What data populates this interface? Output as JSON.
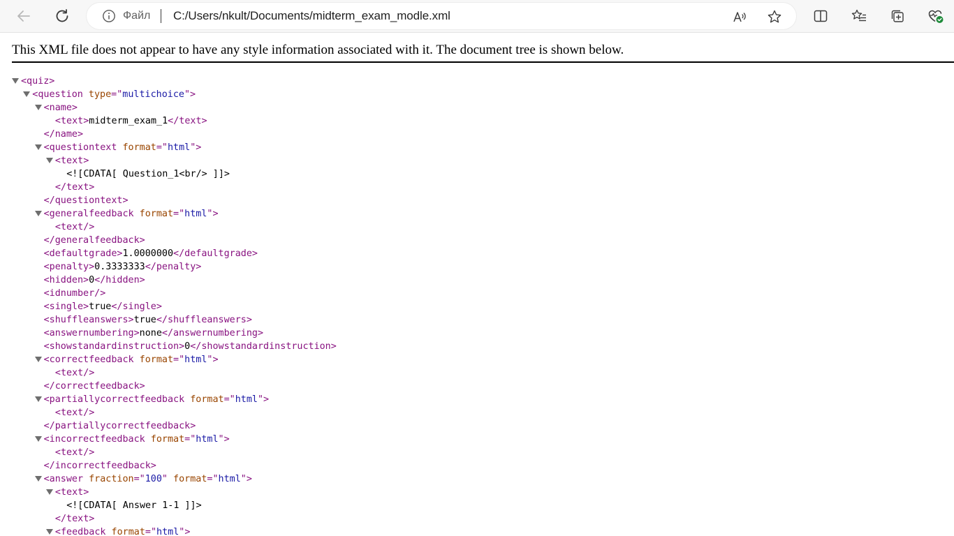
{
  "browser": {
    "site_label": "Файл",
    "url": "C:/Users/nkult/Documents/midterm_exam_modle.xml",
    "icons": {
      "back": "arrow-left-icon",
      "reload": "reload-icon",
      "info": "info-circle-icon",
      "read_aloud": "read-aloud-icon",
      "favorite": "star-icon",
      "split_screen": "split-screen-icon",
      "favorites": "favorites-list-icon",
      "collections": "collections-icon",
      "profile": "heart-pulse-icon"
    }
  },
  "xml_info": "This XML file does not appear to have any style information associated with it. The document tree is shown below.",
  "tree_lines": [
    {
      "indent": 0,
      "tog": true,
      "parts": [
        [
          "tag",
          "<quiz>"
        ]
      ]
    },
    {
      "indent": 1,
      "tog": true,
      "parts": [
        [
          "tag",
          "<question"
        ],
        [
          "txt",
          " "
        ],
        [
          "attr",
          "type"
        ],
        [
          "tag",
          "=\""
        ],
        [
          "val",
          "multichoice"
        ],
        [
          "tag",
          "\">"
        ]
      ]
    },
    {
      "indent": 2,
      "tog": true,
      "parts": [
        [
          "tag",
          "<name>"
        ]
      ]
    },
    {
      "indent": 3,
      "tog": false,
      "parts": [
        [
          "tag",
          "<text>"
        ],
        [
          "txt",
          "midterm_exam_1"
        ],
        [
          "tag",
          "</text>"
        ]
      ]
    },
    {
      "indent": 2,
      "tog": false,
      "parts": [
        [
          "tag",
          "</name>"
        ]
      ]
    },
    {
      "indent": 2,
      "tog": true,
      "parts": [
        [
          "tag",
          "<questiontext"
        ],
        [
          "txt",
          " "
        ],
        [
          "attr",
          "format"
        ],
        [
          "tag",
          "=\""
        ],
        [
          "val",
          "html"
        ],
        [
          "tag",
          "\">"
        ]
      ]
    },
    {
      "indent": 3,
      "tog": true,
      "parts": [
        [
          "tag",
          "<text>"
        ]
      ]
    },
    {
      "indent": 4,
      "tog": false,
      "parts": [
        [
          "txt",
          "<![CDATA[ Question_1<br/> ]]>"
        ]
      ]
    },
    {
      "indent": 3,
      "tog": false,
      "parts": [
        [
          "tag",
          "</text>"
        ]
      ]
    },
    {
      "indent": 2,
      "tog": false,
      "parts": [
        [
          "tag",
          "</questiontext>"
        ]
      ]
    },
    {
      "indent": 2,
      "tog": true,
      "parts": [
        [
          "tag",
          "<generalfeedback"
        ],
        [
          "txt",
          " "
        ],
        [
          "attr",
          "format"
        ],
        [
          "tag",
          "=\""
        ],
        [
          "val",
          "html"
        ],
        [
          "tag",
          "\">"
        ]
      ]
    },
    {
      "indent": 3,
      "tog": false,
      "parts": [
        [
          "tag",
          "<text/>"
        ]
      ]
    },
    {
      "indent": 2,
      "tog": false,
      "parts": [
        [
          "tag",
          "</generalfeedback>"
        ]
      ]
    },
    {
      "indent": 2,
      "tog": false,
      "parts": [
        [
          "tag",
          "<defaultgrade>"
        ],
        [
          "txt",
          "1.0000000"
        ],
        [
          "tag",
          "</defaultgrade>"
        ]
      ]
    },
    {
      "indent": 2,
      "tog": false,
      "parts": [
        [
          "tag",
          "<penalty>"
        ],
        [
          "txt",
          "0.3333333"
        ],
        [
          "tag",
          "</penalty>"
        ]
      ]
    },
    {
      "indent": 2,
      "tog": false,
      "parts": [
        [
          "tag",
          "<hidden>"
        ],
        [
          "txt",
          "0"
        ],
        [
          "tag",
          "</hidden>"
        ]
      ]
    },
    {
      "indent": 2,
      "tog": false,
      "parts": [
        [
          "tag",
          "<idnumber/>"
        ]
      ]
    },
    {
      "indent": 2,
      "tog": false,
      "parts": [
        [
          "tag",
          "<single>"
        ],
        [
          "txt",
          "true"
        ],
        [
          "tag",
          "</single>"
        ]
      ]
    },
    {
      "indent": 2,
      "tog": false,
      "parts": [
        [
          "tag",
          "<shuffleanswers>"
        ],
        [
          "txt",
          "true"
        ],
        [
          "tag",
          "</shuffleanswers>"
        ]
      ]
    },
    {
      "indent": 2,
      "tog": false,
      "parts": [
        [
          "tag",
          "<answernumbering>"
        ],
        [
          "txt",
          "none"
        ],
        [
          "tag",
          "</answernumbering>"
        ]
      ]
    },
    {
      "indent": 2,
      "tog": false,
      "parts": [
        [
          "tag",
          "<showstandardinstruction>"
        ],
        [
          "txt",
          "0"
        ],
        [
          "tag",
          "</showstandardinstruction>"
        ]
      ]
    },
    {
      "indent": 2,
      "tog": true,
      "parts": [
        [
          "tag",
          "<correctfeedback"
        ],
        [
          "txt",
          " "
        ],
        [
          "attr",
          "format"
        ],
        [
          "tag",
          "=\""
        ],
        [
          "val",
          "html"
        ],
        [
          "tag",
          "\">"
        ]
      ]
    },
    {
      "indent": 3,
      "tog": false,
      "parts": [
        [
          "tag",
          "<text/>"
        ]
      ]
    },
    {
      "indent": 2,
      "tog": false,
      "parts": [
        [
          "tag",
          "</correctfeedback>"
        ]
      ]
    },
    {
      "indent": 2,
      "tog": true,
      "parts": [
        [
          "tag",
          "<partiallycorrectfeedback"
        ],
        [
          "txt",
          " "
        ],
        [
          "attr",
          "format"
        ],
        [
          "tag",
          "=\""
        ],
        [
          "val",
          "html"
        ],
        [
          "tag",
          "\">"
        ]
      ]
    },
    {
      "indent": 3,
      "tog": false,
      "parts": [
        [
          "tag",
          "<text/>"
        ]
      ]
    },
    {
      "indent": 2,
      "tog": false,
      "parts": [
        [
          "tag",
          "</partiallycorrectfeedback>"
        ]
      ]
    },
    {
      "indent": 2,
      "tog": true,
      "parts": [
        [
          "tag",
          "<incorrectfeedback"
        ],
        [
          "txt",
          " "
        ],
        [
          "attr",
          "format"
        ],
        [
          "tag",
          "=\""
        ],
        [
          "val",
          "html"
        ],
        [
          "tag",
          "\">"
        ]
      ]
    },
    {
      "indent": 3,
      "tog": false,
      "parts": [
        [
          "tag",
          "<text/>"
        ]
      ]
    },
    {
      "indent": 2,
      "tog": false,
      "parts": [
        [
          "tag",
          "</incorrectfeedback>"
        ]
      ]
    },
    {
      "indent": 2,
      "tog": true,
      "parts": [
        [
          "tag",
          "<answer"
        ],
        [
          "txt",
          " "
        ],
        [
          "attr",
          "fraction"
        ],
        [
          "tag",
          "=\""
        ],
        [
          "val",
          "100"
        ],
        [
          "tag",
          "\""
        ],
        [
          "txt",
          " "
        ],
        [
          "attr",
          "format"
        ],
        [
          "tag",
          "=\""
        ],
        [
          "val",
          "html"
        ],
        [
          "tag",
          "\">"
        ]
      ]
    },
    {
      "indent": 3,
      "tog": true,
      "parts": [
        [
          "tag",
          "<text>"
        ]
      ]
    },
    {
      "indent": 4,
      "tog": false,
      "parts": [
        [
          "txt",
          "<![CDATA[ Answer 1-1 ]]>"
        ]
      ]
    },
    {
      "indent": 3,
      "tog": false,
      "parts": [
        [
          "tag",
          "</text>"
        ]
      ]
    },
    {
      "indent": 3,
      "tog": true,
      "parts": [
        [
          "tag",
          "<feedback"
        ],
        [
          "txt",
          " "
        ],
        [
          "attr",
          "format"
        ],
        [
          "tag",
          "=\""
        ],
        [
          "val",
          "html"
        ],
        [
          "tag",
          "\">"
        ]
      ]
    }
  ]
}
